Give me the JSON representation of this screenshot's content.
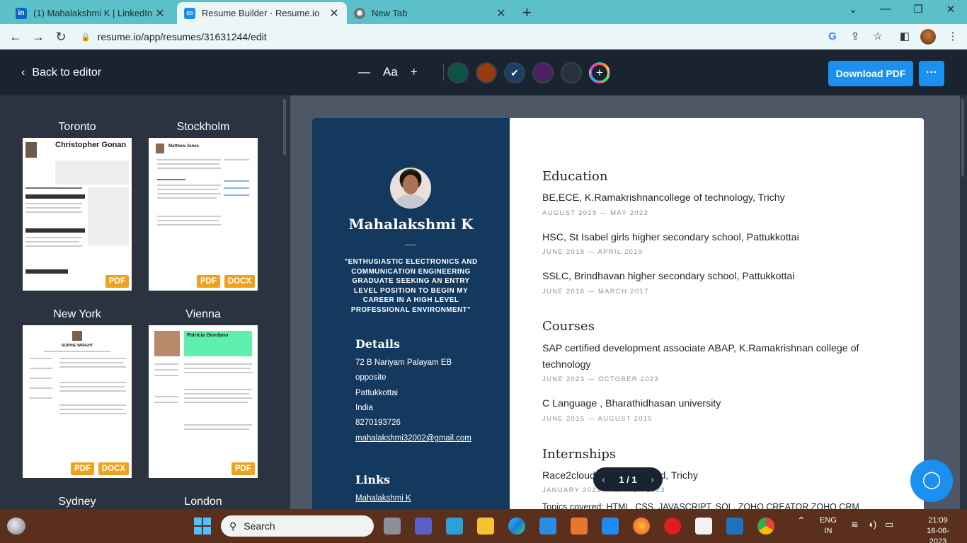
{
  "browser": {
    "tabs": [
      {
        "title": "(1) Mahalakshmi K | LinkedIn",
        "icon": "linkedin-icon"
      },
      {
        "title": "Resume Builder · Resume.io",
        "icon": "resume-io-icon"
      },
      {
        "title": "New Tab",
        "icon": "chrome-icon"
      }
    ],
    "url": "resume.io/app/resumes/31631244/edit"
  },
  "header": {
    "back_label": "Back to editor",
    "font_label": "Aa",
    "download_label": "Download PDF",
    "more_label": "···",
    "colors": [
      "#0d5245",
      "#963a0f",
      "#1b3f66",
      "#4e1f63",
      "#2a303b"
    ],
    "selected_color_index": 2
  },
  "templates": [
    {
      "name": "Toronto",
      "badges": [
        "PDF"
      ],
      "thumb_name": "Christopher Gonan"
    },
    {
      "name": "Stockholm",
      "badges": [
        "PDF",
        "DOCX"
      ],
      "thumb_name": "Matthew Jones"
    },
    {
      "name": "New York",
      "badges": [
        "PDF",
        "DOCX"
      ],
      "thumb_name": "SOPHIE WRIGHT"
    },
    {
      "name": "Vienna",
      "badges": [
        "PDF"
      ],
      "thumb_name": "Patricia Giordano"
    },
    {
      "name": "Sydney",
      "badges": []
    },
    {
      "name": "London",
      "badges": []
    }
  ],
  "resume": {
    "name": "Mahalakshmi K",
    "quote": "\"ENTHUSIASTIC ELECTRONICS AND COMMUNICATION ENGINEERING GRADUATE SEEKING AN ENTRY LEVEL POSITION TO BEGIN MY CAREER IN A HIGH LEVEL PROFESSIONAL ENVIRONMENT\"",
    "details_heading": "Details",
    "details": [
      "72 B Nariyam Palayam EB",
      "opposite",
      "Pattukkottai",
      "India",
      "8270193726"
    ],
    "email": "mahalakshmi32002@gmail.com",
    "links_heading": "Links",
    "link": "Mahalakshmi K",
    "education_heading": "Education",
    "education": [
      {
        "title": "BE,ECE, K.Ramakrishnancollege of technology, Trichy",
        "date": "AUGUST 2019 — MAY 2023"
      },
      {
        "title": "HSC, St Isabel girls higher secondary school, Pattukkottai",
        "date": "JUNE 2018 — APRIL 2019"
      },
      {
        "title": "SSLC, Brindhavan higher secondary school, Pattukkottai",
        "date": "JUNE 2016 — MARCH 2017"
      }
    ],
    "courses_heading": "Courses",
    "courses": [
      {
        "title": "SAP certified development associate ABAP, K.Ramakrishnan college of technology",
        "date": "JUNE 2023 — OCTOBER 2023"
      },
      {
        "title": "C Language , Bharathidhasan university",
        "date": "JUNE 2015 — AUGUST 2015"
      }
    ],
    "internships_heading": "Internships",
    "internship_title": "Race2cloud software pvt ltd, Trichy",
    "internship_date": "JANUARY 2023 — MARCH 2023",
    "internship_desc": "Topics covered: HTML, CSS, JAVASCRIPT, SQL, ZOHO CREATOR,ZOHO CRM"
  },
  "pager": {
    "label": "1 / 1"
  },
  "taskbar": {
    "search_label": "Search",
    "lang": "ENG",
    "region": "IN",
    "time": "21:09",
    "date": "16-06-2023"
  }
}
